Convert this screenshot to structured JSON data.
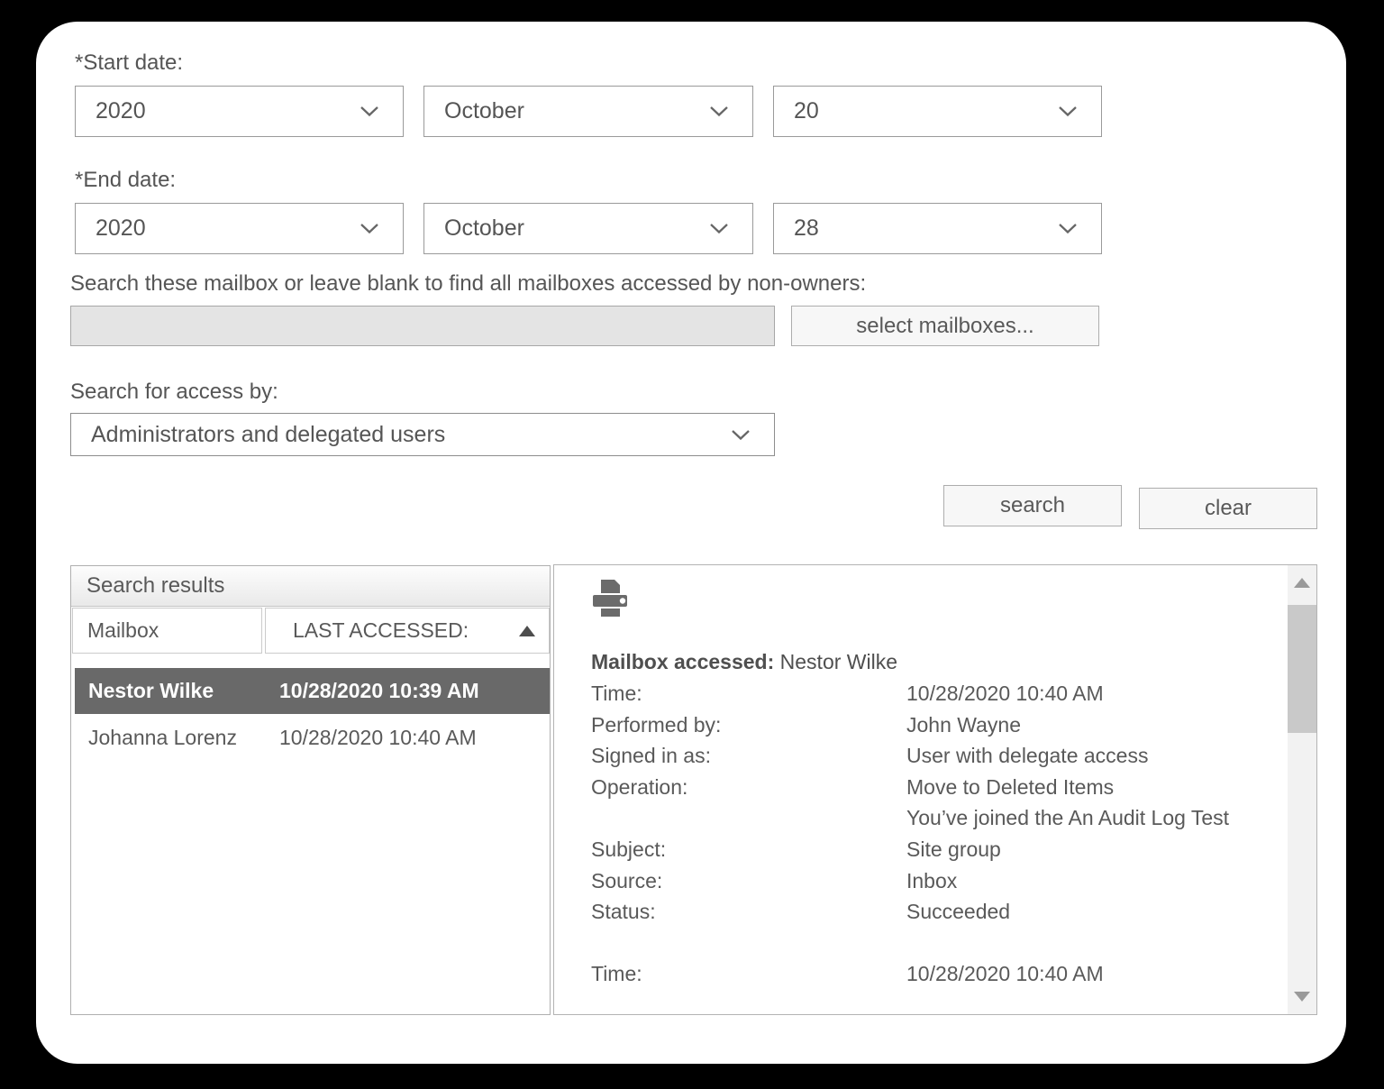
{
  "form": {
    "start_date": {
      "label": "*Start date:",
      "year": "2020",
      "month": "October",
      "day": "20"
    },
    "end_date": {
      "label": "*End date:",
      "year": "2020",
      "month": "October",
      "day": "28"
    },
    "mailbox_search": {
      "label": "Search these mailbox or leave blank to find all mailboxes accessed by non-owners:",
      "input_value": "",
      "select_button_label": "select mailboxes..."
    },
    "access_by": {
      "label": "Search for access by:",
      "selected_option": "Administrators and delegated users"
    },
    "buttons": {
      "search": "search",
      "clear": "clear"
    }
  },
  "results": {
    "title": "Search results",
    "columns": {
      "mailbox": "Mailbox",
      "last_accessed": "LAST ACCESSED:"
    },
    "sort": {
      "column": "last_accessed",
      "direction": "ascending"
    },
    "rows": [
      {
        "mailbox": "Nestor Wilke",
        "last_accessed": "10/28/2020 10:39 AM",
        "selected": true
      },
      {
        "mailbox": "Johanna Lorenz",
        "last_accessed": "10/28/2020 10:40 AM",
        "selected": false
      }
    ]
  },
  "details": {
    "print_icon": "printer-icon",
    "header": {
      "label": "Mailbox accessed:",
      "value": "Nestor Wilke"
    },
    "entries": [
      {
        "label": "Time:",
        "value": "10/28/2020 10:40 AM"
      },
      {
        "label": "Performed by:",
        "value": "John Wayne"
      },
      {
        "label": "Signed in as:",
        "value": "User with delegate access"
      },
      {
        "label": "Operation:",
        "value": "Move to Deleted Items"
      },
      {
        "label": "",
        "value": "You’ve joined the An Audit Log Test"
      },
      {
        "label": "Subject:",
        "value": "Site group"
      },
      {
        "label": "Source:",
        "value": "Inbox"
      },
      {
        "label": "Status:",
        "value": "Succeeded"
      },
      {
        "label": "",
        "value": ""
      },
      {
        "label": "Time:",
        "value": "10/28/2020 10:40 AM"
      }
    ]
  },
  "colors": {
    "selected_row_bg": "#696969",
    "text": "#595959",
    "panel_border": "#b0b0b0",
    "disabled_input_bg": "#e4e4e4"
  }
}
